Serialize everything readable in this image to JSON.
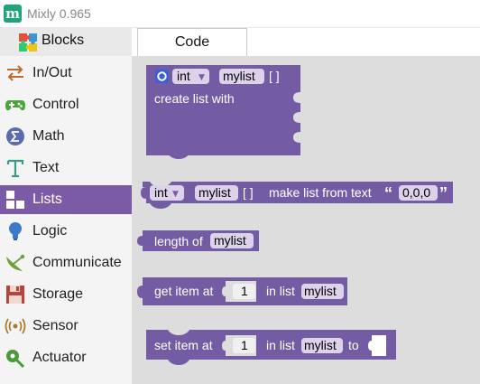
{
  "window": {
    "title": "Mixly 0.965",
    "app_icon": "mixly-logo-icon"
  },
  "sidebar": {
    "tab_label": "Blocks",
    "categories": [
      {
        "label": "In/Out",
        "icon": "arrows-io-icon"
      },
      {
        "label": "Control",
        "icon": "gamepad-icon"
      },
      {
        "label": "Math",
        "icon": "sigma-icon"
      },
      {
        "label": "Text",
        "icon": "text-t-icon"
      },
      {
        "label": "Lists",
        "icon": "list-blocks-icon",
        "selected": true
      },
      {
        "label": "Logic",
        "icon": "bulb-icon"
      },
      {
        "label": "Communicate",
        "icon": "satellite-icon"
      },
      {
        "label": "Storage",
        "icon": "floppy-icon"
      },
      {
        "label": "Sensor",
        "icon": "sensor-waves-icon"
      },
      {
        "label": "Actuator",
        "icon": "actuator-icon"
      }
    ]
  },
  "tabs": {
    "code_label": "Code"
  },
  "colors": {
    "block": "#745ca5",
    "selected_category": "#7b5ba6",
    "workspace": "#dddddd"
  },
  "blocks": {
    "create_list": {
      "type": "int",
      "name": "mylist",
      "brackets": "[ ]",
      "text": "create list with"
    },
    "make_from_text": {
      "type": "int",
      "name": "mylist",
      "brackets": "[ ]",
      "text": "make list from text",
      "value": "0,0,0",
      "open_quote": "“",
      "close_quote": "”"
    },
    "length_of": {
      "text": "length of",
      "list": "mylist"
    },
    "get_item": {
      "text_a": "get item at",
      "index": "1",
      "text_b": "in list",
      "list": "mylist"
    },
    "set_item": {
      "text_a": "set item at",
      "index": "1",
      "text_b": "in list",
      "list": "mylist",
      "text_c": "to"
    }
  }
}
